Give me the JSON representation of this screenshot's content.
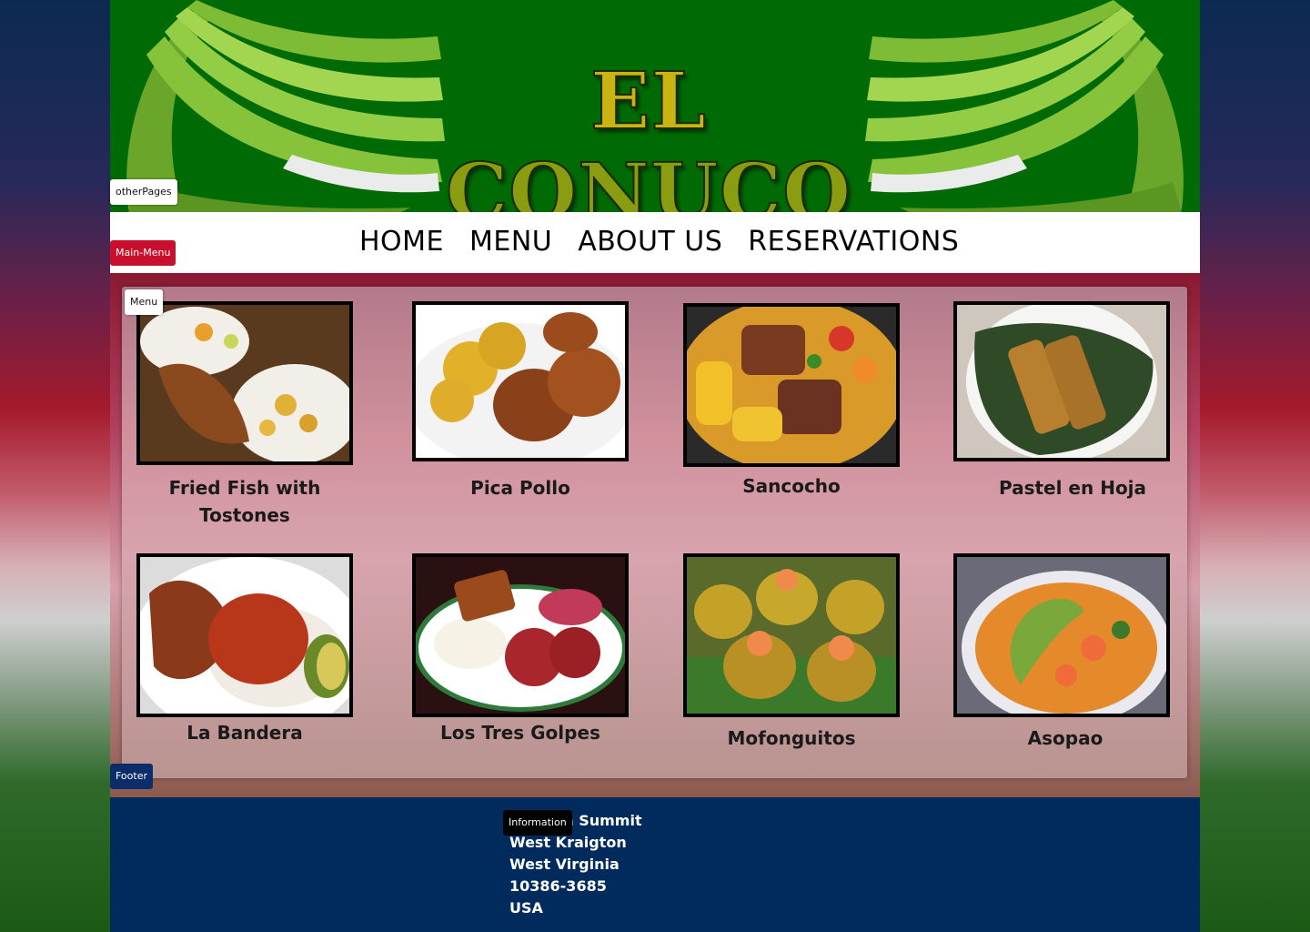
{
  "header": {
    "logo_el": "EL",
    "logo_rest": "CONUCO",
    "tag_other_pages": "otherPages"
  },
  "nav": {
    "tag": "Main-Menu",
    "links": [
      "HOME",
      "MENU",
      "ABOUT US",
      "RESERVATIONS"
    ]
  },
  "menu": {
    "tag": "Menu",
    "dishes": [
      {
        "name": "Fried Fish with Tostones"
      },
      {
        "name": "Pica Pollo"
      },
      {
        "name": "Sancocho"
      },
      {
        "name": "Pastel en Hoja"
      },
      {
        "name": "La Bandera"
      },
      {
        "name": "Los Tres Golpes"
      },
      {
        "name": "Mofonguitos"
      },
      {
        "name": "Asopao"
      }
    ]
  },
  "footer": {
    "tag": "Footer",
    "info_tag": "Information",
    "address": [
      "Chelsea Summit",
      "West Kraigton",
      "West Virginia",
      "10386-3685",
      "USA"
    ]
  }
}
